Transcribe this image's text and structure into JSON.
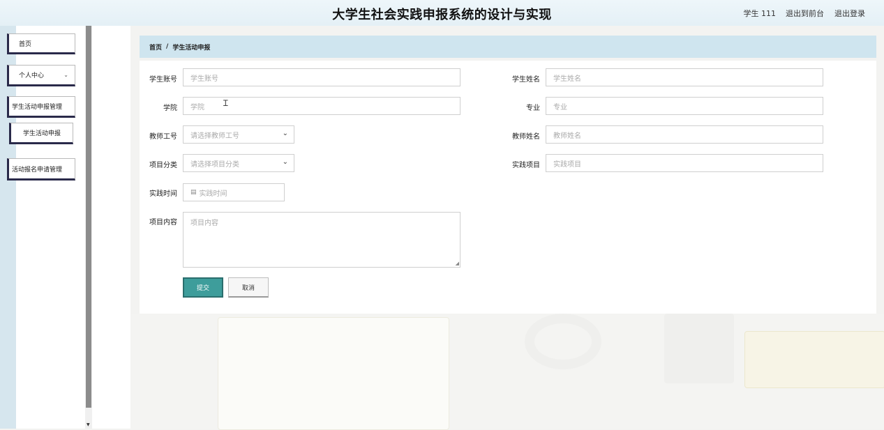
{
  "header": {
    "title": "大学生社会实践申报系统的设计与实现",
    "user": "学生 111",
    "front_link": "退出到前台",
    "logout_link": "退出登录"
  },
  "sidebar": {
    "items": [
      {
        "label": "首页"
      },
      {
        "label": "个人中心",
        "chevron": "⌄"
      },
      {
        "label": "学生活动申报管理"
      },
      {
        "label": "学生活动申报"
      },
      {
        "label": "活动报名申请管理"
      }
    ]
  },
  "breadcrumb": {
    "home": "首页",
    "separator": "/",
    "current": "学生活动申报"
  },
  "form": {
    "student_account": {
      "label": "学生账号",
      "placeholder": "学生账号"
    },
    "student_name": {
      "label": "学生姓名",
      "placeholder": "学生姓名"
    },
    "college": {
      "label": "学院",
      "placeholder": "学院"
    },
    "major": {
      "label": "专业",
      "placeholder": "专业"
    },
    "teacher_id": {
      "label": "教师工号",
      "placeholder": "请选择教师工号"
    },
    "teacher_name": {
      "label": "教师姓名",
      "placeholder": "教师姓名"
    },
    "project_category": {
      "label": "项目分类",
      "placeholder": "请选择项目分类"
    },
    "practice_project": {
      "label": "实践项目",
      "placeholder": "实践项目"
    },
    "practice_time": {
      "label": "实践时间",
      "placeholder": "实践时间"
    },
    "project_content": {
      "label": "项目内容",
      "placeholder": "项目内容"
    },
    "submit_label": "提交",
    "cancel_label": "取消"
  },
  "colors": {
    "header_bg": "#e4f0f6",
    "breadcrumb_bg": "#cfe5ef",
    "submit_bg": "#3e9d9b",
    "menu_accent": "#2a2a4a"
  }
}
